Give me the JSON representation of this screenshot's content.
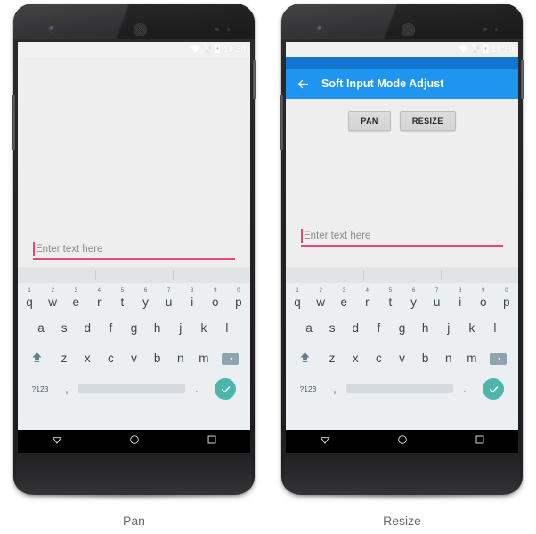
{
  "figure": {
    "captions": [
      {
        "label": "Pan"
      },
      {
        "label": "Resize"
      }
    ]
  },
  "statusbar": {
    "time": "10:30",
    "icons": [
      "wifi-icon",
      "signal-off-icon",
      "battery-icon"
    ]
  },
  "appbar": {
    "back_icon": "back-arrow-icon",
    "title": "Soft Input Mode Adjust"
  },
  "buttons": {
    "pan": "PAN",
    "resize": "RESIZE"
  },
  "edit_text": {
    "value": "",
    "hint": "Enter text here",
    "accent": "#e8457f"
  },
  "keyboard": {
    "row_numbers": [
      "1",
      "2",
      "3",
      "4",
      "5",
      "6",
      "7",
      "8",
      "9",
      "0"
    ],
    "row1": [
      "q",
      "w",
      "e",
      "r",
      "t",
      "y",
      "u",
      "i",
      "o",
      "p"
    ],
    "row2": [
      "a",
      "s",
      "d",
      "f",
      "g",
      "h",
      "j",
      "k",
      "l"
    ],
    "row3": [
      "z",
      "x",
      "c",
      "v",
      "b",
      "n",
      "m"
    ],
    "shift_icon": "shift-icon",
    "delete_icon": "backspace-icon",
    "symbols_label": "?123",
    "comma_label": ",",
    "period_label": ".",
    "enter_icon": "check-icon",
    "enter_color": "#4db6ac"
  },
  "navbar": {
    "back_icon": "nav-back-triangle-icon",
    "home_icon": "nav-home-circle-icon",
    "recents_icon": "nav-recents-square-icon"
  },
  "colors": {
    "appbar": "#1e95f0",
    "appbar_dark": "#1275d0",
    "screen_bg": "#eeeeee",
    "keyboard_bg": "#eceff1"
  }
}
